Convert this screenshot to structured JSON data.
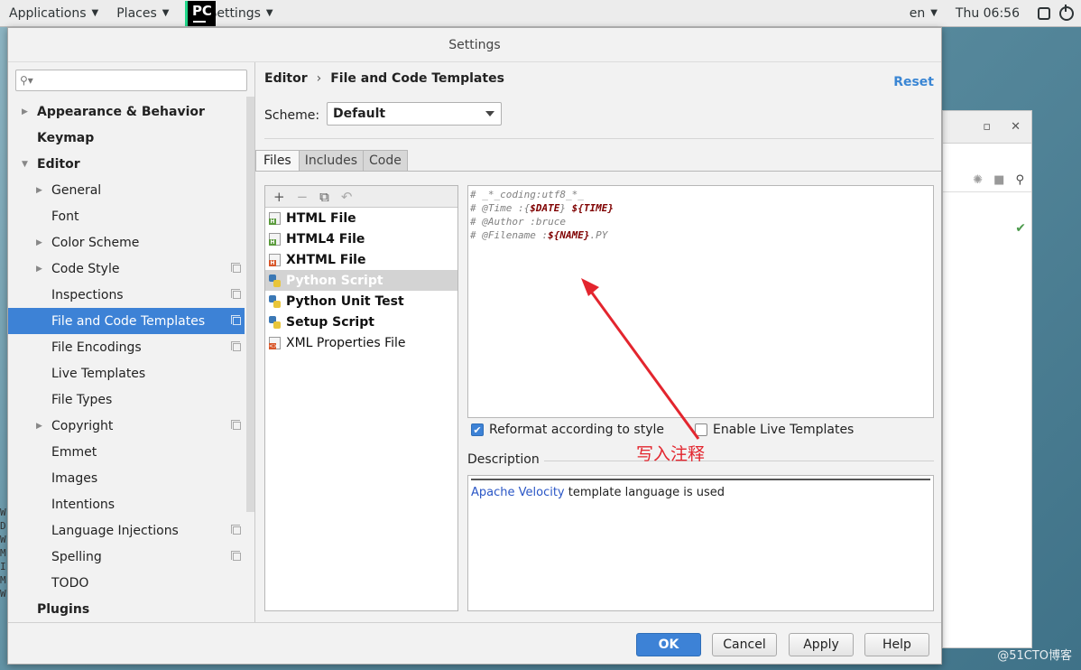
{
  "topbar": {
    "applications": "Applications",
    "places": "Places",
    "active_window": "Settings",
    "logo_text": "PC",
    "language": "en",
    "clock": "Thu 06:56"
  },
  "dialog": {
    "title": "Settings",
    "search_placeholder": ""
  },
  "tree": {
    "appearance": "Appearance & Behavior",
    "keymap": "Keymap",
    "editor": "Editor",
    "general": "General",
    "font": "Font",
    "color_scheme": "Color Scheme",
    "code_style": "Code Style",
    "inspections": "Inspections",
    "file_code_templates": "File and Code Templates",
    "file_encodings": "File Encodings",
    "live_templates": "Live Templates",
    "file_types": "File Types",
    "copyright": "Copyright",
    "emmet": "Emmet",
    "images": "Images",
    "intentions": "Intentions",
    "language_injections": "Language Injections",
    "spelling": "Spelling",
    "todo": "TODO",
    "plugins": "Plugins"
  },
  "content": {
    "breadcrumb_parent": "Editor",
    "breadcrumb_sep": "›",
    "breadcrumb_current": "File and Code Templates",
    "reset": "Reset",
    "scheme_label": "Scheme:",
    "scheme_value": "Default",
    "tabs": {
      "files": "Files",
      "includes": "Includes",
      "code": "Code"
    }
  },
  "templates": {
    "toolbar": {
      "add": "+",
      "remove": "−",
      "copy": "⧉",
      "revert": "↶"
    },
    "items": [
      "HTML File",
      "HTML4 File",
      "XHTML File",
      "Python Script",
      "Python Unit Test",
      "Setup Script",
      "XML Properties File"
    ]
  },
  "editor": {
    "line1": "# _*_coding:utf8_*_",
    "line2_prefix": "# @Time  :{",
    "line2_var1": "$DATE",
    "line2_mid": "} ",
    "line2_var2": "${TIME}",
    "line3": "# @Author :bruce",
    "line4_prefix": "# @Filename :",
    "line4_var": "${NAME}",
    "line4_suffix": ".PY"
  },
  "options": {
    "reformat": "Reformat according to style",
    "live_templates": "Enable Live Templates",
    "reformat_checked": true,
    "live_checked": false
  },
  "annotation": "写入注释",
  "description": {
    "label": "Description",
    "link": "Apache Velocity",
    "text": " template language is used"
  },
  "buttons": {
    "ok": "OK",
    "cancel": "Cancel",
    "apply": "Apply",
    "help": "Help"
  },
  "watermark": "@51CTO博客",
  "colors": {
    "accent": "#3d82d6",
    "annotation": "#e3252e",
    "link": "#3a86d4"
  }
}
